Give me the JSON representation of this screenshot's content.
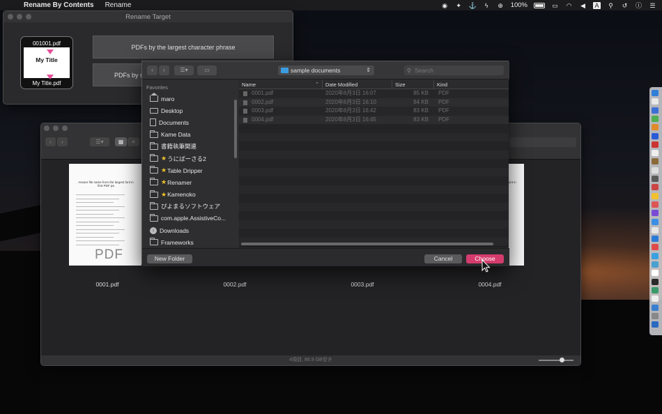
{
  "menubar": {
    "app_name": "Rename By Contents",
    "menus": [
      "Rename"
    ],
    "battery": "100%"
  },
  "rename_window": {
    "title": "Rename Target",
    "preview_file": "001001.pdf",
    "preview_title": "My Title",
    "preview_output": "My Title.pdf",
    "option1": "PDFs by the largest character phrase",
    "option2": "PDFs by m"
  },
  "finder": {
    "files": [
      {
        "name": "0001.pdf"
      },
      {
        "name": "0002.pdf"
      },
      {
        "name": "0003.pdf"
      },
      {
        "name": "0004.pdf"
      }
    ],
    "doc_heading": "Assure file name from the largest\nfont in first PDF pa",
    "pdf_label": "PDF",
    "status": "4項目, 86.9 GB空き"
  },
  "dialog": {
    "location": "sample documents",
    "search_placeholder": "Search",
    "favorites_header": "Favorites",
    "sidebar": [
      {
        "label": "maro",
        "icon": "home-icon"
      },
      {
        "label": "Desktop",
        "icon": "desktop-icon"
      },
      {
        "label": "Documents",
        "icon": "document-icon"
      },
      {
        "label": "Kame Data",
        "icon": "folder-icon"
      },
      {
        "label": "書籍執筆関連",
        "icon": "folder-icon"
      },
      {
        "label": "うにばーさる2",
        "icon": "folder-icon",
        "star": true
      },
      {
        "label": "Table Dripper",
        "icon": "folder-icon",
        "star": true
      },
      {
        "label": "Renamer",
        "icon": "folder-icon",
        "star": true
      },
      {
        "label": "Kamenoko",
        "icon": "folder-icon",
        "star": true
      },
      {
        "label": "ぴよまるソフトウェア",
        "icon": "folder-icon"
      },
      {
        "label": "com.apple.AssistiveCo...",
        "icon": "folder-icon"
      },
      {
        "label": "Downloads",
        "icon": "download-icon"
      },
      {
        "label": "Frameworks",
        "icon": "folder-icon"
      }
    ],
    "columns": {
      "name": "Name",
      "date": "Date Modified",
      "size": "Size",
      "kind": "Kind"
    },
    "rows": [
      {
        "name": "0001.pdf",
        "date": "2020年8月3日 16:07",
        "size": "85 KB",
        "kind": "PDF"
      },
      {
        "name": "0002.pdf",
        "date": "2020年8月3日 16:10",
        "size": "84 KB",
        "kind": "PDF"
      },
      {
        "name": "0003.pdf",
        "date": "2020年8月3日 16:42",
        "size": "83 KB",
        "kind": "PDF"
      },
      {
        "name": "0004.pdf",
        "date": "2020年8月3日 16:45",
        "size": "83 KB",
        "kind": "PDF"
      }
    ],
    "new_folder": "New Folder",
    "cancel": "Cancel",
    "choose": "Choose"
  },
  "colors": {
    "accent": "#d53c6e",
    "folder_blue": "#3b9ce0"
  }
}
